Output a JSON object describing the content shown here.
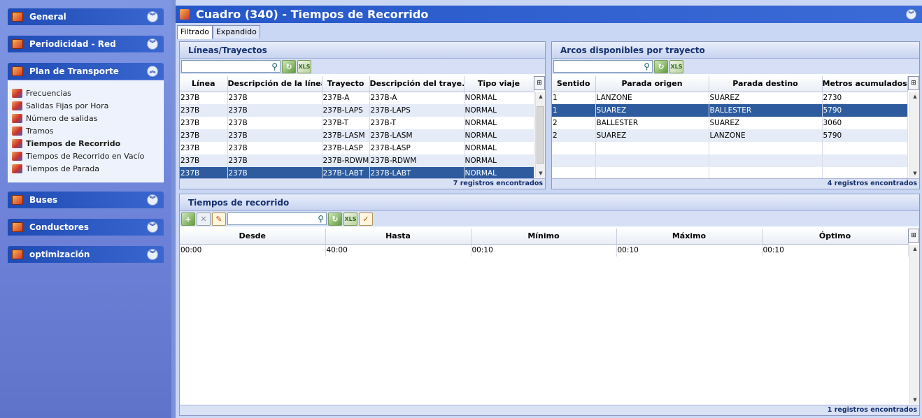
{
  "sidebar": {
    "groups": [
      {
        "label": "General"
      },
      {
        "label": "Periodicidad - Red"
      },
      {
        "label": "Plan de Transporte"
      },
      {
        "label": "Buses"
      },
      {
        "label": "Conductores"
      },
      {
        "label": "optimización"
      }
    ],
    "plan_items": [
      {
        "label": "Frecuencias"
      },
      {
        "label": "Salidas Fijas por Hora"
      },
      {
        "label": "Número de salidas"
      },
      {
        "label": "Tramos"
      },
      {
        "label": "Tiempos de Recorrido"
      },
      {
        "label": "Tiempos de Recorrido en Vacío"
      },
      {
        "label": "Tiempos de Parada"
      }
    ]
  },
  "header": {
    "title": "Cuadro (340) - Tiempos de Recorrido"
  },
  "tabs": [
    {
      "label": "Filtrado"
    },
    {
      "label": "Expandido"
    }
  ],
  "lineas": {
    "title": "Líneas/Trayectos",
    "columns": [
      "Línea",
      "Descripción de la línea",
      "Trayecto",
      "Descripción del traye...",
      "Tipo viaje"
    ],
    "rows": [
      [
        "237B",
        "237B",
        "237B-A",
        "237B-A",
        "NORMAL"
      ],
      [
        "237B",
        "237B",
        "237B-LAPS",
        "237B-LAPS",
        "NORMAL"
      ],
      [
        "237B",
        "237B",
        "237B-T",
        "237B-T",
        "NORMAL"
      ],
      [
        "237B",
        "237B",
        "237B-LASM",
        "237B-LASM",
        "NORMAL"
      ],
      [
        "237B",
        "237B",
        "237B-LASP",
        "237B-LASP",
        "NORMAL"
      ],
      [
        "237B",
        "237B",
        "237B-RDWM",
        "237B-RDWM",
        "NORMAL"
      ],
      [
        "237B",
        "237B",
        "237B-LABT",
        "237B-LABT",
        "NORMAL"
      ]
    ],
    "selected_row": 6,
    "footer": "7 registros encontrados"
  },
  "arcos": {
    "title": "Arcos disponibles por trayecto",
    "columns": [
      "Sentido",
      "Parada origen",
      "Parada destino",
      "Metros acumulados"
    ],
    "rows": [
      [
        "1",
        "LANZONE",
        "SUAREZ",
        "2730"
      ],
      [
        "1",
        "SUAREZ",
        "BALLESTER",
        "5790"
      ],
      [
        "2",
        "BALLESTER",
        "SUAREZ",
        "3060"
      ],
      [
        "2",
        "SUAREZ",
        "LANZONE",
        "5790"
      ]
    ],
    "selected_row": 1,
    "footer": "4 registros encontrados"
  },
  "tiempos": {
    "title": "Tiempos de recorrido",
    "columns": [
      "Desde",
      "Hasta",
      "Mínimo",
      "Máximo",
      "Óptimo"
    ],
    "rows": [
      [
        "00:00",
        "40:00",
        "00:10",
        "00:10",
        "00:10"
      ]
    ],
    "footer": "1 registros encontrados"
  },
  "colors": {
    "accent": "#2657c9",
    "selection": "#2d5b9e"
  },
  "icons": [
    "chevron-down-icon",
    "chevron-up-icon",
    "search-icon",
    "refresh-icon",
    "excel-icon",
    "add-icon",
    "delete-icon",
    "edit-icon",
    "check-icon",
    "column-chooser-icon"
  ]
}
